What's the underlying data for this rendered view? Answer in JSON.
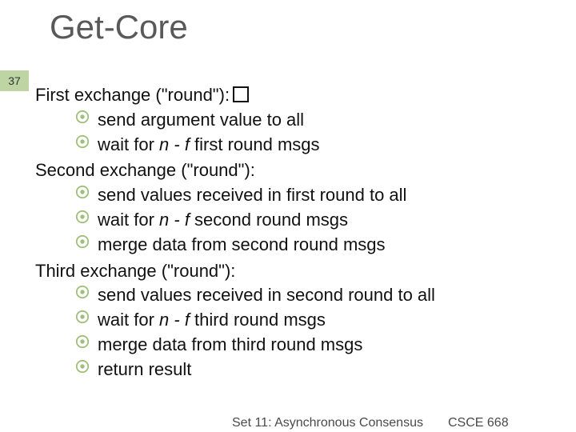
{
  "title": "Get-Core",
  "page_number": "37",
  "sections": [
    {
      "heading": "First exchange (\"round\"):",
      "heading_suffix_box": true,
      "items": [
        {
          "pre": "send argument value to all"
        },
        {
          "pre": "wait for ",
          "em": "n - f",
          "post": " first round msgs"
        }
      ]
    },
    {
      "heading": "Second exchange (\"round\"):",
      "heading_suffix_box": false,
      "items": [
        {
          "pre": "send values received in first round to all"
        },
        {
          "pre": "wait for ",
          "em": "n - f",
          "post": " second round msgs"
        },
        {
          "pre": "merge data from second round msgs"
        }
      ]
    },
    {
      "heading": "Third exchange (\"round\"):",
      "heading_suffix_box": false,
      "items": [
        {
          "pre": "send values received in second round to all"
        },
        {
          "pre": "wait for ",
          "em": "n - f",
          "post": " third round msgs"
        },
        {
          "pre": "merge data from third round msgs"
        },
        {
          "pre": "return result"
        }
      ]
    }
  ],
  "footer_left": "Set 11: Asynchronous Consensus",
  "footer_right": "CSCE 668"
}
